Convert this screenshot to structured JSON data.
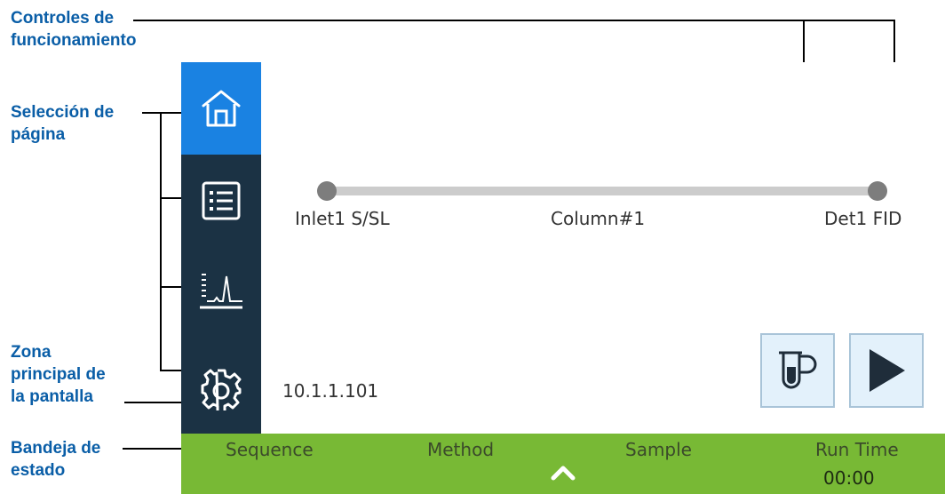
{
  "callouts": {
    "operation_controls": "Controles de\nfuncionamiento",
    "page_selection": "Selección de\npágina",
    "main_screen_area": "Zona\nprincipal de\nla pantalla",
    "status_tray": "Bandeja de\nestado"
  },
  "nav": {
    "items": [
      {
        "name": "home",
        "icon": "home-icon",
        "active": true
      },
      {
        "name": "list",
        "icon": "list-icon",
        "active": false
      },
      {
        "name": "chromatogram",
        "icon": "chromatogram-icon",
        "active": false
      },
      {
        "name": "settings",
        "icon": "gear-icon",
        "active": false
      }
    ],
    "active_color": "#1a82e2",
    "background_color": "#1b3244"
  },
  "flow_path": {
    "inlet": "Inlet1 S/SL",
    "column": "Column#1",
    "detector": "Det1 FID"
  },
  "ip_address": "10.1.1.101",
  "controls": {
    "prep_run_icon": "vial-prep-run-icon",
    "start_icon": "play-icon",
    "button_color": "#e3f1fb"
  },
  "status_tray": {
    "sequence_label": "Sequence",
    "method_label": "Method",
    "sample_label": "Sample",
    "run_time_label": "Run Time",
    "run_time_value": "00:00",
    "toggle_icon": "chevron-up-icon",
    "color": "#78b935"
  }
}
